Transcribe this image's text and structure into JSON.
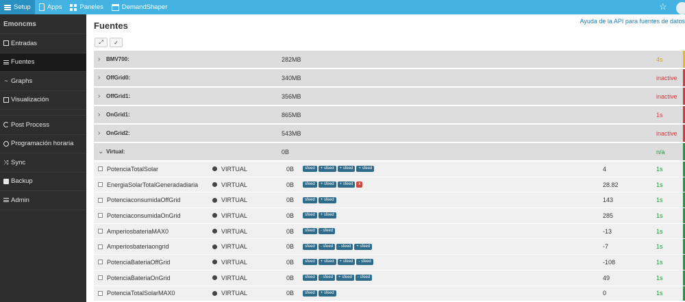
{
  "topnav": {
    "items": [
      {
        "label": "Setup",
        "icon": "menu-icon",
        "active": true
      },
      {
        "label": "Apps",
        "icon": "tablet-icon",
        "active": false
      },
      {
        "label": "Paneles",
        "icon": "grid-icon",
        "active": false
      },
      {
        "label": "DemandShaper",
        "icon": "calendar-icon",
        "active": false
      }
    ],
    "star_glyph": "☆"
  },
  "sidebar": {
    "brand": "Emoncms",
    "items": [
      {
        "label": "Entradas",
        "icon": "inputs-icon"
      },
      {
        "label": "Fuentes",
        "icon": "list-icon",
        "active": true
      },
      {
        "label": "Graphs",
        "icon": "chart-line-icon"
      },
      {
        "label": "Visualización",
        "icon": "visualization-icon"
      },
      {
        "label": "Post Process",
        "icon": "refresh-icon"
      },
      {
        "label": "Programación horaria",
        "icon": "clock-icon"
      },
      {
        "label": "Sync",
        "icon": "shuffle-icon"
      },
      {
        "label": "Backup",
        "icon": "camera-icon"
      },
      {
        "label": "Admin",
        "icon": "server-icon"
      }
    ]
  },
  "main": {
    "title": "Fuentes",
    "api_link": "Ayuda de la API para fuentes de datos",
    "tool_glyphs": [
      "⤢",
      "✓"
    ]
  },
  "groups": [
    {
      "name": "BMV700:",
      "size": "282MB",
      "status": "4s",
      "status_color": "#e29a1a",
      "bar_color": "#f0b429",
      "expanded": false
    },
    {
      "name": "OffGrid0:",
      "size": "340MB",
      "status": "inactive",
      "status_color": "#d9383a",
      "bar_color": "#d9383a",
      "expanded": false
    },
    {
      "name": "OffGrid1:",
      "size": "356MB",
      "status": "inactive",
      "status_color": "#d9383a",
      "bar_color": "#d9383a",
      "expanded": false
    },
    {
      "name": "OnGrid1:",
      "size": "865MB",
      "status": "1s",
      "status_color": "#d9383a",
      "bar_color": "#d9383a",
      "expanded": false
    },
    {
      "name": "OnGrid2:",
      "size": "543MB",
      "status": "inactive",
      "status_color": "#d9383a",
      "bar_color": "#d9383a",
      "expanded": false
    },
    {
      "name": "Virtual:",
      "size": "0B",
      "status": "n/a",
      "status_color": "#1a9a3a",
      "bar_color": "#1a9a3a",
      "expanded": true
    }
  ],
  "feeds": [
    {
      "name": "PotenciaTotalSolar",
      "engine": "VIRTUAL",
      "size": "0B",
      "processes": [
        "sfeed",
        "+ sfeed",
        "+ sfeed",
        "+ sfeed"
      ],
      "value": "4",
      "interval": "1s"
    },
    {
      "name": "EnergiaSolarTotalGeneradadiaria",
      "engine": "VIRTUAL",
      "size": "0B",
      "processes": [
        "sfeed",
        "+ sfeed",
        "+ sfeed",
        "x"
      ],
      "value": "28.82",
      "interval": "1s"
    },
    {
      "name": "PotenciaconsumidaOffGrid",
      "engine": "VIRTUAL",
      "size": "0B",
      "processes": [
        "sfeed",
        "+ sfeed"
      ],
      "value": "143",
      "interval": "1s"
    },
    {
      "name": "PotenciaconsumidaOnGrid",
      "engine": "VIRTUAL",
      "size": "0B",
      "processes": [
        "sfeed",
        "+ sfeed"
      ],
      "value": "285",
      "interval": "1s"
    },
    {
      "name": "AmperiosbateriaMAX0",
      "engine": "VIRTUAL",
      "size": "0B",
      "processes": [
        "sfeed",
        "- sfeed"
      ],
      "value": "-13",
      "interval": "1s"
    },
    {
      "name": "Amperiosbateriaongrid",
      "engine": "VIRTUAL",
      "size": "0B",
      "processes": [
        "sfeed",
        "- sfeed",
        "- sfeed",
        "+ sfeed"
      ],
      "value": "-7",
      "interval": "1s"
    },
    {
      "name": "PotenciaBateriaOffGrid",
      "engine": "VIRTUAL",
      "size": "0B",
      "processes": [
        "sfeed",
        "+ sfeed",
        "+ sfeed",
        "- sfeed"
      ],
      "value": "-108",
      "interval": "1s"
    },
    {
      "name": "PotenciaBateriaOnGrid",
      "engine": "VIRTUAL",
      "size": "0B",
      "processes": [
        "sfeed",
        "- sfeed",
        "+ sfeed",
        "- sfeed"
      ],
      "value": "49",
      "interval": "1s"
    },
    {
      "name": "PotenciaTotalSolarMAX0",
      "engine": "VIRTUAL",
      "size": "0B",
      "processes": [
        "sfeed",
        "+ sfeed"
      ],
      "value": "0",
      "interval": "1s"
    }
  ],
  "colors": {
    "accent": "#44b3e2",
    "ok": "#1a9a3a",
    "error": "#d9383a",
    "warn": "#f0b429",
    "badge": "#2e6b8a"
  }
}
